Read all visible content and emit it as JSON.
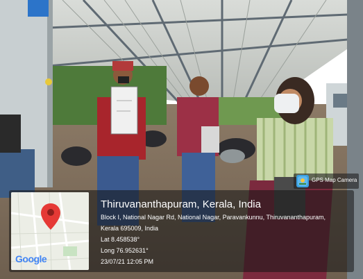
{
  "location": {
    "title": "Thiruvananthapuram, Kerala, India",
    "address_line1": "Block I, National Nagar Rd, National Nagar, Paravankunnu, Thiruvananthapuram,",
    "address_line2": "Kerala 695009, India",
    "lat": "Lat 8.458538°",
    "long": "Long 76.952631°",
    "timestamp": "23/07/21 12:05 PM"
  },
  "badge": {
    "label": "GPS Map Camera",
    "icon": "gps-map-camera-icon"
  },
  "map": {
    "logo_text": "Google",
    "pin_color": "#e53935"
  },
  "sign_text": "",
  "colors": {
    "overlay": "#141414",
    "pin": "#e53935",
    "roof": "#cfd3cf"
  }
}
